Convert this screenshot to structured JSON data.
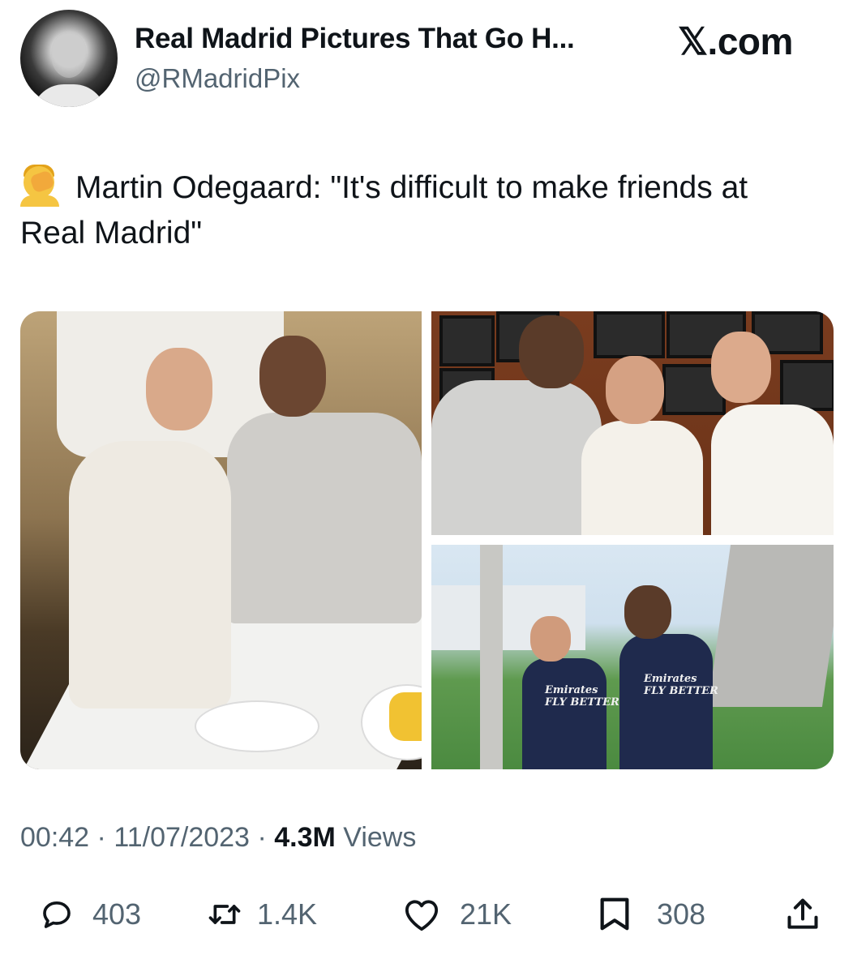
{
  "header": {
    "display_name": "Real Madrid Pictures That Go H...",
    "handle": "@RMadridPix",
    "source": "𝕏.com"
  },
  "tweet": {
    "emoji": "person-facepalming-emoji",
    "text": "Martin Odegaard: \"It's difficult to make friends at Real Madrid\""
  },
  "media": {
    "photo_count": 3,
    "photos": [
      {
        "name": "dinner-photo"
      },
      {
        "name": "restaurant-group-photo"
      },
      {
        "name": "training-ground-photo",
        "sponsor_1": "Emirates\nFLY BETTER",
        "sponsor_2": "Emirates\nFLY BETTER"
      }
    ]
  },
  "meta": {
    "time": "00:42",
    "date": "11/07/2023",
    "views_count": "4.3M",
    "views_label": "Views",
    "separator": "·"
  },
  "actions": {
    "replies": "403",
    "reposts": "1.4K",
    "likes": "21K",
    "bookmarks": "308"
  },
  "icons": [
    "reply-icon",
    "repost-icon",
    "like-icon",
    "bookmark-icon",
    "share-icon"
  ],
  "colors": {
    "text": "#0f1419",
    "secondary": "#536471",
    "background": "#ffffff"
  }
}
